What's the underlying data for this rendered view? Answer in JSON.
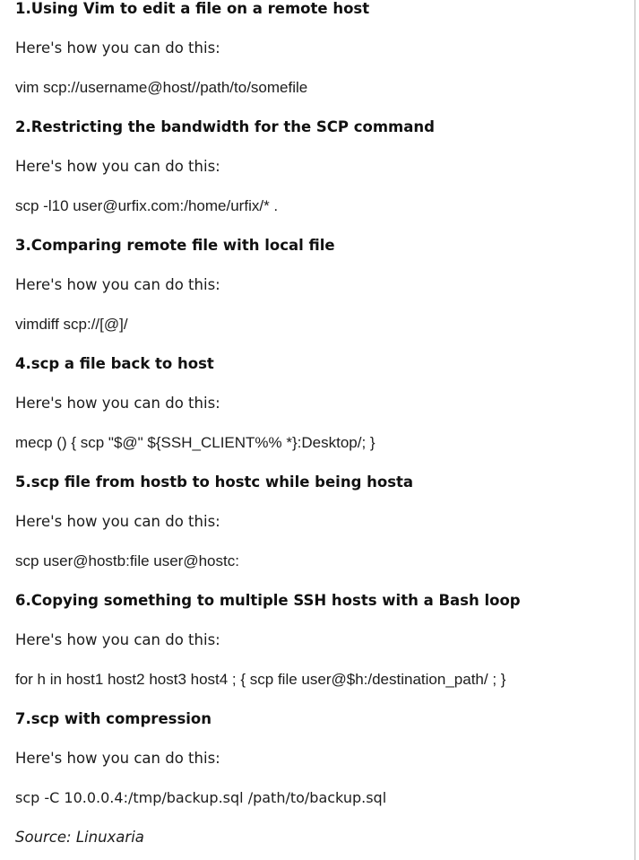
{
  "sections": [
    {
      "heading": "1.Using Vim to edit a file on a remote host",
      "intro": "Here's how you can do this:",
      "command": "vim scp://username@host//path/to/somefile"
    },
    {
      "heading": "2.Restricting the bandwidth for the SCP command",
      "intro": "Here's how you can do this:",
      "command": "scp -l10 user@urfix.com:/home/urfix/* ."
    },
    {
      "heading": "3.Comparing remote file with local file",
      "intro": "Here's how you can do this:",
      "command": "vimdiff scp://[@]/"
    },
    {
      "heading": "4.scp a file back to host",
      "intro": "Here's how you can do this:",
      "command": "mecp () { scp \"$@\" ${SSH_CLIENT%% *}:Desktop/; }"
    },
    {
      "heading": "5.scp file from hostb to hostc while being hosta",
      "intro": "Here's how you can do this:",
      "command": "scp user@hostb:file user@hostc:"
    },
    {
      "heading": "6.Copying something to multiple SSH hosts with a Bash loop",
      "intro": "Here's how you can do this:",
      "command": "for h in host1 host2 host3 host4 ; { scp file user@$h:/destination_path/ ; }"
    },
    {
      "heading": "7.scp with compression",
      "intro": "Here's how you can do this:",
      "command": "scp -C 10.0.0.4:/tmp/backup.sql /path/to/backup.sql"
    }
  ],
  "source": "Source: Linuxaria"
}
